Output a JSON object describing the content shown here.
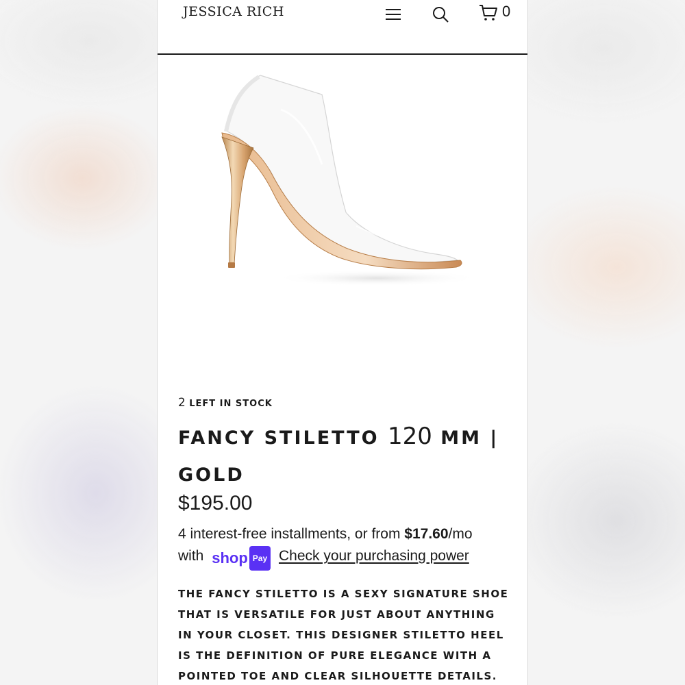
{
  "header": {
    "logo": "JESSICA RICH",
    "cart_count": "0",
    "icons": [
      "menu-icon",
      "search-icon",
      "cart-icon"
    ]
  },
  "product": {
    "image_alt": "Clear pointed-toe stiletto pump with gold heel",
    "stock_number": "2",
    "stock_text": "left in stock",
    "title_part1": "Fancy Stiletto",
    "title_number": "120",
    "title_part2": "mm | Gold",
    "price": "$195.00",
    "installments_prefix": "4 interest-free installments, or from ",
    "installments_amount": "$17.60",
    "installments_suffix": "/mo",
    "installments_with": "with",
    "shop_pay_word": "shop",
    "shop_pay_badge": "Pay",
    "purchasing_power_link": "Check your purchasing power",
    "description": "The Fancy Stiletto is a sexy signature shoe that is versatile for just about anything in your closet. This designer stiletto heel is the definition of pure elegance with a pointed toe and clear silhouette details."
  },
  "colors": {
    "text": "#1a1a1a",
    "shop_pay": "#5a31f4",
    "heel_gold": "#d9a878"
  }
}
